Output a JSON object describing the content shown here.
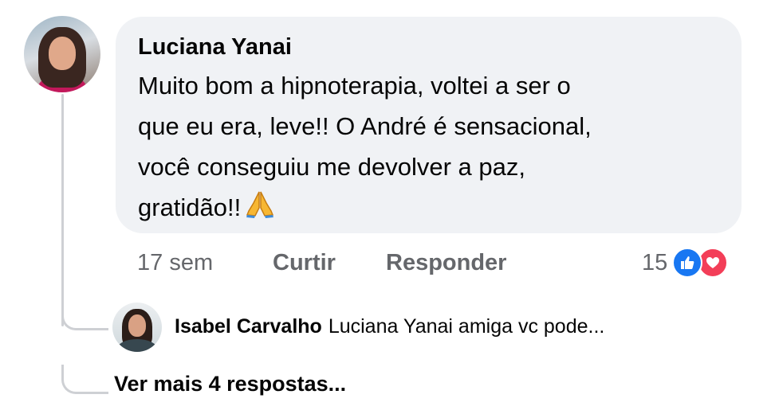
{
  "comment": {
    "author": "Luciana Yanai",
    "text": "Muito bom a hipnoterapia, voltei a ser o\nque eu era, leve!! O André é sensacional,\nvocê conseguiu me devolver a paz,\ngratidão!!",
    "emoji": "folded-hands",
    "time": "17 sem",
    "like_label": "Curtir",
    "reply_label": "Responder",
    "reaction_count": "15",
    "reaction_icons": [
      "like-icon",
      "love-icon"
    ],
    "colors": {
      "like": "#1877f2",
      "love": "#f33e58",
      "bubble": "#f0f2f5",
      "meta": "#65676b"
    }
  },
  "reply": {
    "author": "Isabel Carvalho",
    "text": "Luciana Yanai amiga vc pode..."
  },
  "more_replies_label": "Ver mais 4 respostas..."
}
